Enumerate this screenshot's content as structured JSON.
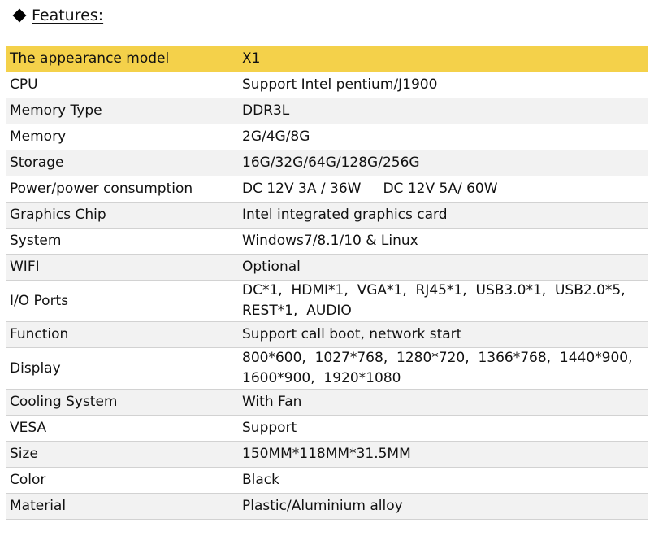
{
  "heading": {
    "text": "Features:"
  },
  "table": {
    "header": {
      "label": "The appearance model",
      "value": "X1"
    },
    "rows": [
      {
        "label": "CPU",
        "value": "Support Intel pentium/J1900"
      },
      {
        "label": "Memory Type",
        "value": "DDR3L"
      },
      {
        "label": "Memory",
        "value": "2G/4G/8G"
      },
      {
        "label": "Storage",
        "value": "16G/32G/64G/128G/256G"
      },
      {
        "label": "Power/power consumption",
        "value": "DC 12V 3A / 36W     DC 12V 5A/ 60W"
      },
      {
        "label": "Graphics Chip",
        "value": "Intel integrated graphics card"
      },
      {
        "label": "System",
        "value": "Windows7/8.1/10 & Linux"
      },
      {
        "label": "WIFI",
        "value": "Optional"
      },
      {
        "label": "I/O Ports",
        "value": "DC*1,  HDMI*1,  VGA*1,  RJ45*1,  USB3.0*1,  USB2.0*5,  REST*1,  AUDIO"
      },
      {
        "label": "Function",
        "value": "Support call boot, network start"
      },
      {
        "label": "Display",
        "value": "800*600,  1027*768,  1280*720,  1366*768,  1440*900,  1600*900,  1920*1080"
      },
      {
        "label": "Cooling System",
        "value": "With Fan"
      },
      {
        "label": "VESA",
        "value": "Support"
      },
      {
        "label": "Size",
        "value": "150MM*118MM*31.5MM"
      },
      {
        "label": "Color",
        "value": "Black"
      },
      {
        "label": "Material",
        "value": "Plastic/Aluminium alloy"
      }
    ]
  }
}
